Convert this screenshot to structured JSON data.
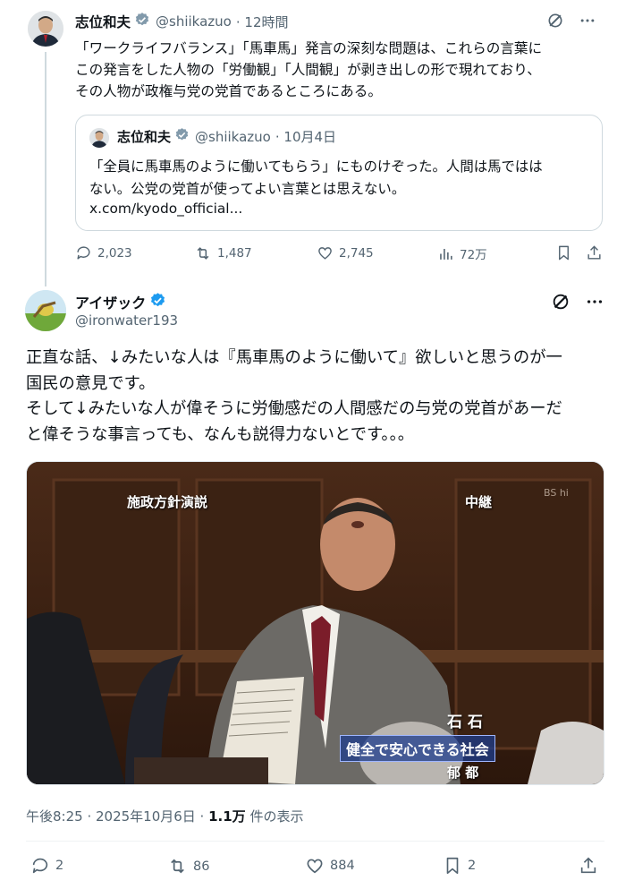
{
  "tweet1": {
    "name": "志位和夫",
    "handle": "@shiikazuo",
    "time": "· 12時間",
    "body_lines": [
      "「ワークライフバランス」「馬車馬」発言の深刻な問題は、これらの言葉に",
      "この発言をした人物の「労働観」「人間観」が剥き出しの形で現れており、",
      "その人物が政権与党の党首であるところにある。"
    ],
    "quote": {
      "name": "志位和夫",
      "handle": "@shiikazuo",
      "date": "· 10月4日",
      "body_lines": [
        "「全員に馬車馬のように働いてもらう」にものけぞった。人間は馬ではは",
        "ない。公党の党首が使ってよい言葉とは思えない。"
      ],
      "link": "x.com/kyodo_official..."
    },
    "actions": {
      "replies": "2,023",
      "reposts": "1,487",
      "likes": "2,745",
      "views": "72万"
    }
  },
  "tweet2": {
    "name": "アイザック",
    "handle": "@ironwater193",
    "body_lines": [
      "正直な話、↓みたいな人は『馬車馬のように働いて』欲しいと思うのが一",
      "国民の意見です。",
      "そして↓みたいな人が偉そうに労働感だの人間感だの与党の党首があーだ",
      "と偉そうな事言っても、なんも説得力ないとです。。。"
    ],
    "photo": {
      "caption_top_left": "施政方針演説",
      "caption_top_right": "中継",
      "caption_corner": "BS hi",
      "name_tag": "石 石",
      "subtitle": "健全で安心できる社会",
      "lower_tag": "郁 都"
    },
    "meta": {
      "time": "午後8:25 · 2025年10月6日 · ",
      "views": "1.1万",
      "views_suffix": " 件の表示"
    },
    "actions": {
      "replies": "2",
      "reposts": "86",
      "likes": "884",
      "bookmarks": "2"
    }
  },
  "colors": {
    "verified": "#1d9bf0",
    "muted": "#536471",
    "text": "#0f1419",
    "border": "#cfd9de"
  }
}
